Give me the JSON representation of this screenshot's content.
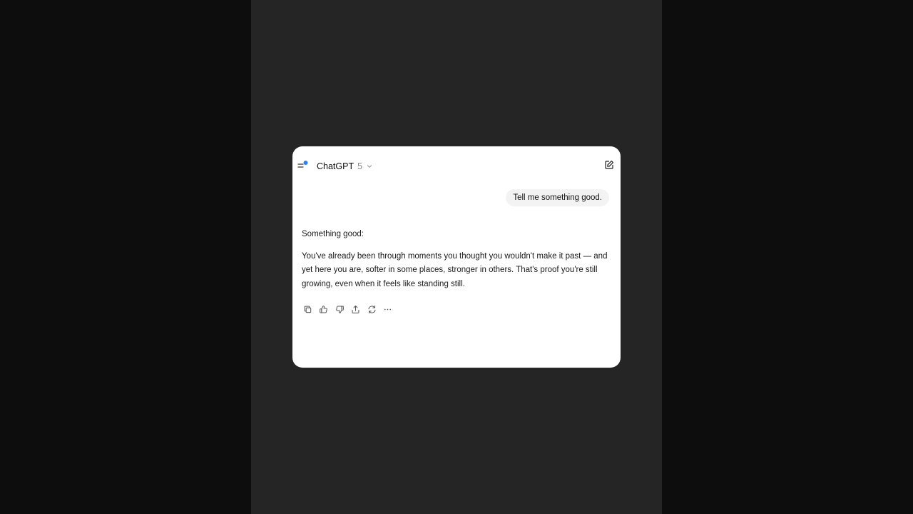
{
  "header": {
    "model_name": "ChatGPT",
    "model_version": "5",
    "notification_color": "#2f7ff0"
  },
  "conversation": {
    "user_message": "Tell me something good.",
    "assistant_paragraphs": [
      "Something good:",
      "You've already been through moments you thought you wouldn't make it past — and yet here you are, softer in some places, stronger in others. That's proof you're still growing, even when it feels like standing still."
    ]
  },
  "actions": [
    {
      "icon": "copy-icon"
    },
    {
      "icon": "thumbs-up-icon"
    },
    {
      "icon": "thumbs-down-icon"
    },
    {
      "icon": "share-icon"
    },
    {
      "icon": "regenerate-icon"
    },
    {
      "icon": "more-icon"
    }
  ]
}
